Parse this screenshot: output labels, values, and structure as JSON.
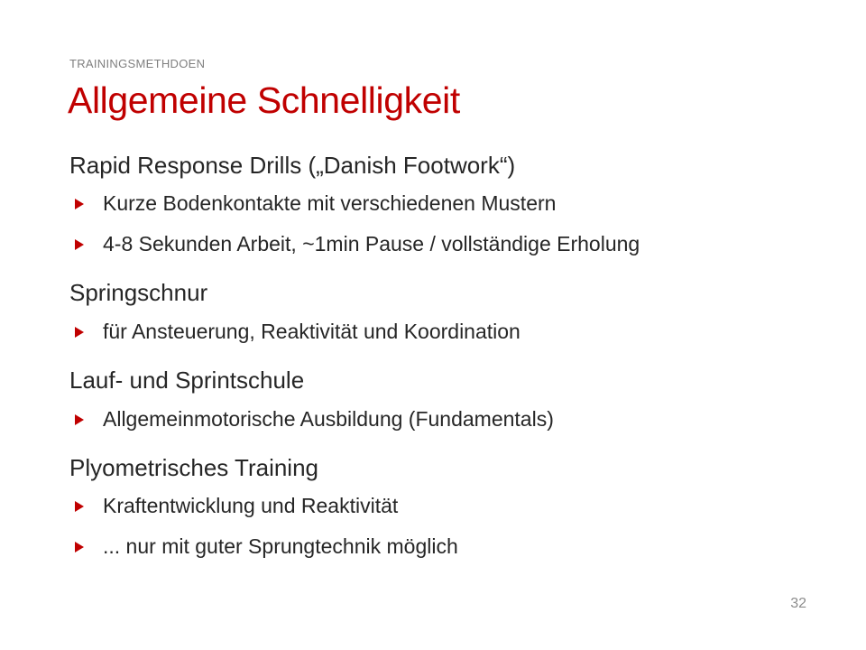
{
  "slide": {
    "kicker": "TRAININGSMETHDOEN",
    "title": "Allgemeine Schnelligkeit",
    "page_number": "32"
  },
  "sections": [
    {
      "heading": "Rapid Response Drills („Danish Footwork“)",
      "bullets": [
        "Kurze Bodenkontakte mit verschiedenen Mustern",
        "4-8 Sekunden Arbeit, ~1min Pause / vollständige Erholung"
      ]
    },
    {
      "heading": "Springschnur",
      "bullets": [
        "für Ansteuerung, Reaktivität und Koordination"
      ]
    },
    {
      "heading": "Lauf- und Sprintschule",
      "bullets": [
        "Allgemeinmotorische Ausbildung (Fundamentals)"
      ]
    },
    {
      "heading": "Plyometrisches Training",
      "bullets": [
        "Kraftentwicklung und Reaktivität",
        "... nur mit guter Sprungtechnik möglich"
      ]
    }
  ],
  "colors": {
    "accent": "#c00000",
    "text": "#262626",
    "muted": "#7f7f7f"
  },
  "icons": {
    "bullet": "triangle-right-icon"
  }
}
